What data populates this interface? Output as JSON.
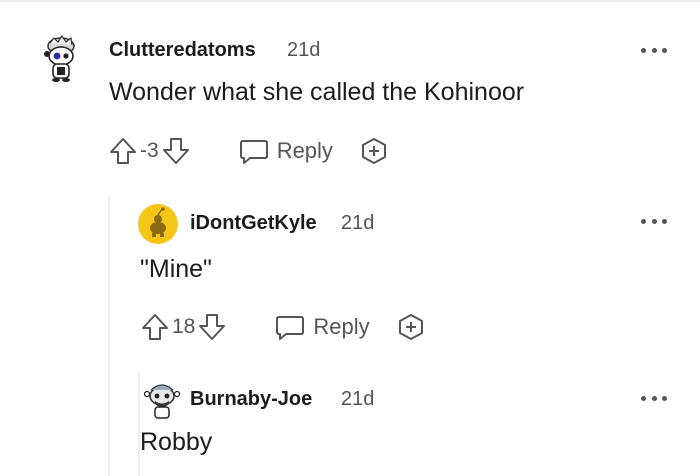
{
  "comments": [
    {
      "username": "Clutteredatoms",
      "time": "21d",
      "text": "Wonder what she called the Kohinoor",
      "score": "-3",
      "reply_label": "Reply",
      "avatar_icon": "snoo-avatar-icon"
    },
    {
      "username": "iDontGetKyle",
      "time": "21d",
      "text": "\"Mine\"",
      "score": "18",
      "reply_label": "Reply",
      "avatar_icon": "snoo-yellow-avatar-icon"
    },
    {
      "username": "Burnaby-Joe",
      "time": "21d",
      "text": "Robby",
      "avatar_icon": "snoo-avatar-icon"
    }
  ],
  "colors": {
    "icon_gray": "#555555",
    "avatar_yellow": "#f5c518",
    "thread_line": "#edeff1"
  }
}
